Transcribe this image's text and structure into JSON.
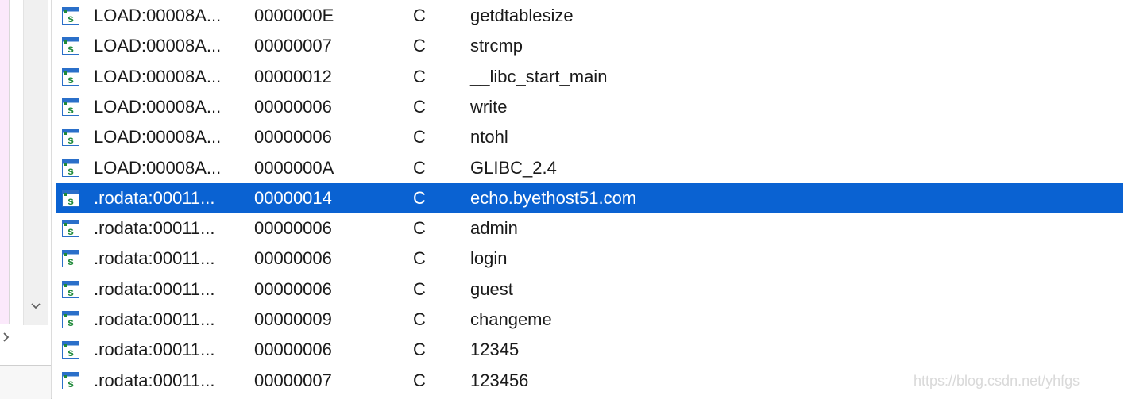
{
  "sidebar": {
    "scroll_down_glyph": "⌄",
    "scroll_right_glyph": "›"
  },
  "strings_window": {
    "rows": [
      {
        "address": "LOAD:00008A...",
        "length": "0000000E",
        "type": "C",
        "string": "getdtablesize",
        "selected": false
      },
      {
        "address": "LOAD:00008A...",
        "length": "00000007",
        "type": "C",
        "string": "strcmp",
        "selected": false
      },
      {
        "address": "LOAD:00008A...",
        "length": "00000012",
        "type": "C",
        "string": "__libc_start_main",
        "selected": false
      },
      {
        "address": "LOAD:00008A...",
        "length": "00000006",
        "type": "C",
        "string": "write",
        "selected": false
      },
      {
        "address": "LOAD:00008A...",
        "length": "00000006",
        "type": "C",
        "string": "ntohl",
        "selected": false
      },
      {
        "address": "LOAD:00008A...",
        "length": "0000000A",
        "type": "C",
        "string": "GLIBC_2.4",
        "selected": false
      },
      {
        "address": ".rodata:00011...",
        "length": "00000014",
        "type": "C",
        "string": "echo.byethost51.com",
        "selected": true
      },
      {
        "address": ".rodata:00011...",
        "length": "00000006",
        "type": "C",
        "string": "admin",
        "selected": false
      },
      {
        "address": ".rodata:00011...",
        "length": "00000006",
        "type": "C",
        "string": "login",
        "selected": false
      },
      {
        "address": ".rodata:00011...",
        "length": "00000006",
        "type": "C",
        "string": "guest",
        "selected": false
      },
      {
        "address": ".rodata:00011...",
        "length": "00000009",
        "type": "C",
        "string": "changeme",
        "selected": false
      },
      {
        "address": ".rodata:00011...",
        "length": "00000006",
        "type": "C",
        "string": "12345",
        "selected": false
      },
      {
        "address": ".rodata:00011...",
        "length": "00000007",
        "type": "C",
        "string": "123456",
        "selected": false
      }
    ],
    "icon": "string-s-icon",
    "colors": {
      "selection": "#0a62d2",
      "icon_green": "#1f8a3a",
      "icon_blue": "#2a6fc9"
    }
  },
  "watermark": "https://blog.csdn.net/yhfgs"
}
